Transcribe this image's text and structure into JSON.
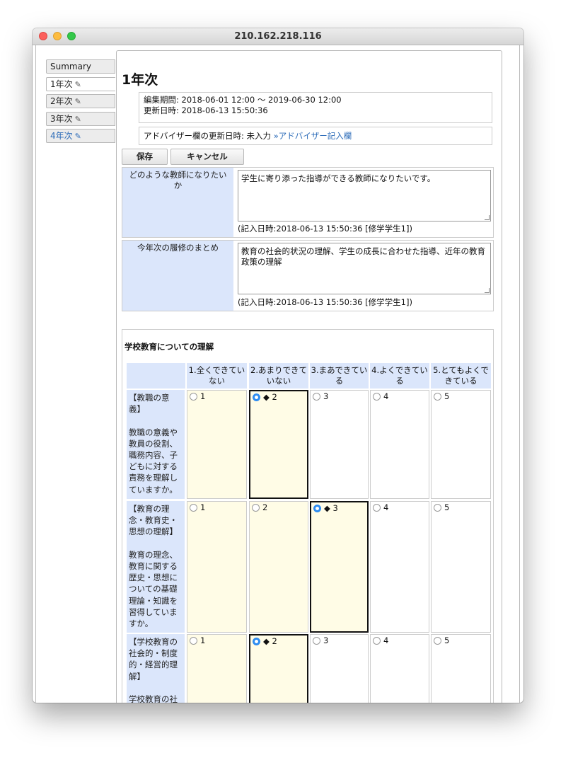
{
  "window": {
    "title": "210.162.218.116"
  },
  "tabs": [
    {
      "label": "Summary",
      "edit": false
    },
    {
      "label": "1年次",
      "edit": true
    },
    {
      "label": "2年次",
      "edit": true
    },
    {
      "label": "3年次",
      "edit": true
    },
    {
      "label": "4年次",
      "edit": true
    }
  ],
  "page": {
    "heading": "1年次",
    "edit_period": "編集期間: 2018-06-01 12:00 〜 2019-06-30 12:00",
    "updated_at": "更新日時: 2018-06-13 15:50:36",
    "advisor_status": "アドバイザー欄の更新日時: 未入力",
    "advisor_link": "»アドバイザー記入欄"
  },
  "buttons": {
    "save": "保存",
    "cancel": "キャンセル"
  },
  "questions": [
    {
      "label": "どのような教師になりたいか",
      "answer": "学生に寄り添った指導ができる教師になりたいです。",
      "meta": "(記入日時:2018-06-13 15:50:36 [修学学生1])"
    },
    {
      "label": "今年次の履修のまとめ",
      "answer": "教育の社会的状況の理解、学生の成長に合わせた指導、近年の教育政策の理解",
      "meta": "(記入日時:2018-06-13 15:50:36 [修学学生1])"
    }
  ],
  "rubric": {
    "title": "学校教育についての理解",
    "scale": [
      "1.全くできていない",
      "2.あまりできていない",
      "3.まあできている",
      "4.よくできている",
      "5.とてもよくできている"
    ],
    "options": [
      "1",
      "2",
      "3",
      "4",
      "5"
    ],
    "selected_marker": "◆",
    "items": [
      {
        "label": "【教職の意義】\n\n教職の意義や教員の役割、職務内容、子どもに対する責務を理解していますか。",
        "selected": 2
      },
      {
        "label": "【教育の理念・教育史・思想の理解】\n\n教育の理念、教育に関する歴史・思想についての基礎理論・知識を習得していますか。",
        "selected": 3
      },
      {
        "label": "【学校教育の社会的・制度的・経営的理解】\n\n学校教育の社会的・制度的",
        "selected": 2
      }
    ]
  },
  "colors": {
    "label_bg": "#dbe6fb",
    "highlight_bg": "#fffce6",
    "link": "#2b6bb8",
    "radio_on": "#2e8cf0"
  }
}
